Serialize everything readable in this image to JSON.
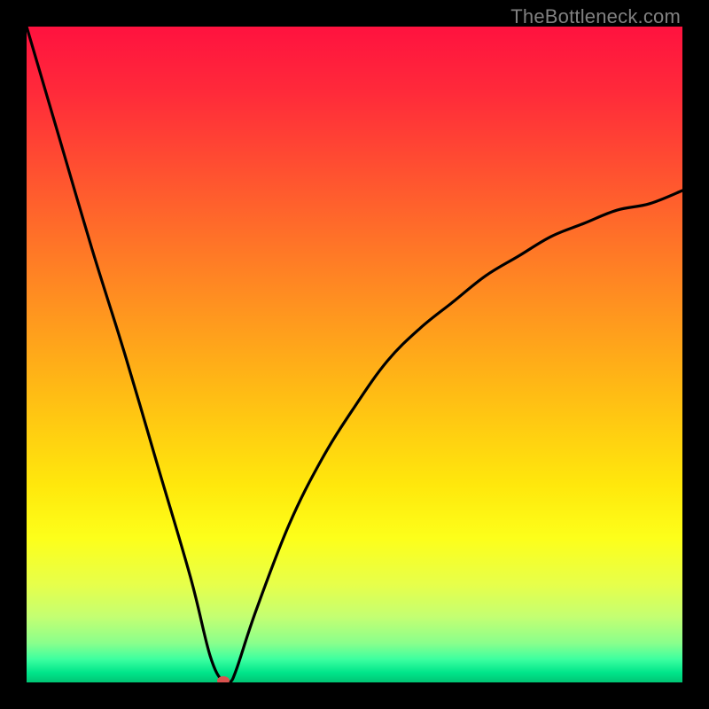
{
  "watermark": "TheBottleneck.com",
  "chart_data": {
    "type": "line",
    "title": "",
    "xlabel": "",
    "ylabel": "",
    "xlim": [
      0,
      100
    ],
    "ylim": [
      0,
      100
    ],
    "grid": false,
    "legend": false,
    "curve_description": "V-shaped bottleneck curve descending steeply from top-left, reaching a minimum near x≈30, then rising asymptotically toward ~75% at the right edge.",
    "min_point": {
      "x": 30,
      "y": 0
    },
    "series": [
      {
        "name": "bottleneck",
        "x": [
          0,
          5,
          10,
          15,
          20,
          25,
          28,
          30,
          31,
          32,
          35,
          40,
          45,
          50,
          55,
          60,
          65,
          70,
          75,
          80,
          85,
          90,
          95,
          100
        ],
        "y": [
          100,
          83,
          66,
          50,
          33,
          16,
          4,
          0,
          0,
          2,
          11,
          24,
          34,
          42,
          49,
          54,
          58,
          62,
          65,
          68,
          70,
          72,
          73,
          75
        ]
      }
    ],
    "background_gradient_stops": [
      {
        "offset": 0.0,
        "color": "#ff123f"
      },
      {
        "offset": 0.1,
        "color": "#ff2a3a"
      },
      {
        "offset": 0.25,
        "color": "#ff5a2e"
      },
      {
        "offset": 0.4,
        "color": "#ff8a22"
      },
      {
        "offset": 0.55,
        "color": "#ffb915"
      },
      {
        "offset": 0.7,
        "color": "#ffe80c"
      },
      {
        "offset": 0.78,
        "color": "#fdff1a"
      },
      {
        "offset": 0.85,
        "color": "#e7ff4a"
      },
      {
        "offset": 0.9,
        "color": "#c4ff72"
      },
      {
        "offset": 0.94,
        "color": "#8aff8c"
      },
      {
        "offset": 0.965,
        "color": "#3cffa0"
      },
      {
        "offset": 0.985,
        "color": "#00e58a"
      },
      {
        "offset": 1.0,
        "color": "#00c574"
      }
    ],
    "marker": {
      "x": 30,
      "y": 0,
      "color": "#d9534f",
      "rx": 7,
      "ry": 5
    }
  }
}
